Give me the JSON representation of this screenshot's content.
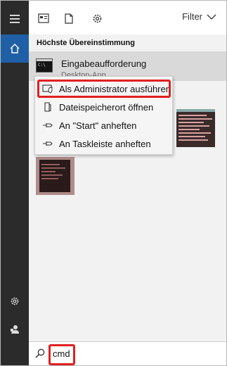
{
  "topbar": {
    "filter_label": "Filter"
  },
  "main": {
    "section_title": "Höchste Übereinstimmung",
    "best_match": {
      "title": "Eingabeaufforderung",
      "subtitle": "Desktop-App"
    }
  },
  "context_menu": {
    "items": [
      {
        "label": "Als Administrator ausführen",
        "icon": "shield-icon"
      },
      {
        "label": "Dateispeicherort öffnen",
        "icon": "folder-icon"
      },
      {
        "label": "An \"Start\" anheften",
        "icon": "pin-icon"
      },
      {
        "label": "An Taskleiste anheften",
        "icon": "pin-icon"
      }
    ]
  },
  "search": {
    "value": "cmd"
  },
  "colors": {
    "rail": "#2b2b2b",
    "active": "#1f5fa5",
    "highlight": "#e02020"
  }
}
